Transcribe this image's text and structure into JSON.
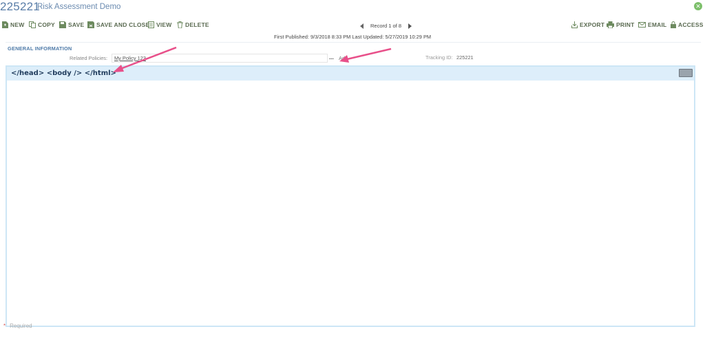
{
  "header": {
    "record_id": "225221",
    "app_name": "Risk Assessment Demo",
    "close_icon": "close-circle-icon"
  },
  "toolbar": {
    "items": [
      {
        "label": "NEW",
        "icon": "new-document-icon"
      },
      {
        "label": "COPY",
        "icon": "copy-icon"
      },
      {
        "label": "SAVE",
        "icon": "save-icon"
      },
      {
        "label": "SAVE AND CLOSE",
        "icon": "save-close-icon"
      },
      {
        "label": "VIEW",
        "icon": "view-icon"
      },
      {
        "label": "DELETE",
        "icon": "trash-icon"
      }
    ],
    "right_items": [
      {
        "label": "EXPORT",
        "icon": "export-icon"
      },
      {
        "label": "PRINT",
        "icon": "printer-icon"
      },
      {
        "label": "EMAIL",
        "icon": "envelope-icon"
      },
      {
        "label": "ACCESS",
        "icon": "lock-icon"
      }
    ]
  },
  "pager": {
    "label": "Record 1 of 8"
  },
  "published": "First Published: 9/3/2018 8:33 PM Last Updated: 5/27/2019 10:29 PM",
  "general": {
    "section_title": "GENERAL INFORMATION",
    "related_policies_label": "Related Policies:",
    "related_policies_value": "My Policy 123",
    "lookup": "...",
    "add": "Add",
    "tracking_label": "Tracking ID:",
    "tracking_value": "225221"
  },
  "panel": {
    "title": "</head> <body /> </html>"
  },
  "footer": {
    "required_star": "*",
    "required_text": "Required"
  },
  "colors": {
    "accent": "#5a7ea8",
    "panel_header": "#ddeefa",
    "panel_border": "#cde6f6",
    "toolbar_text": "#5b6b52",
    "annotation_arrow": "#e8508a"
  }
}
